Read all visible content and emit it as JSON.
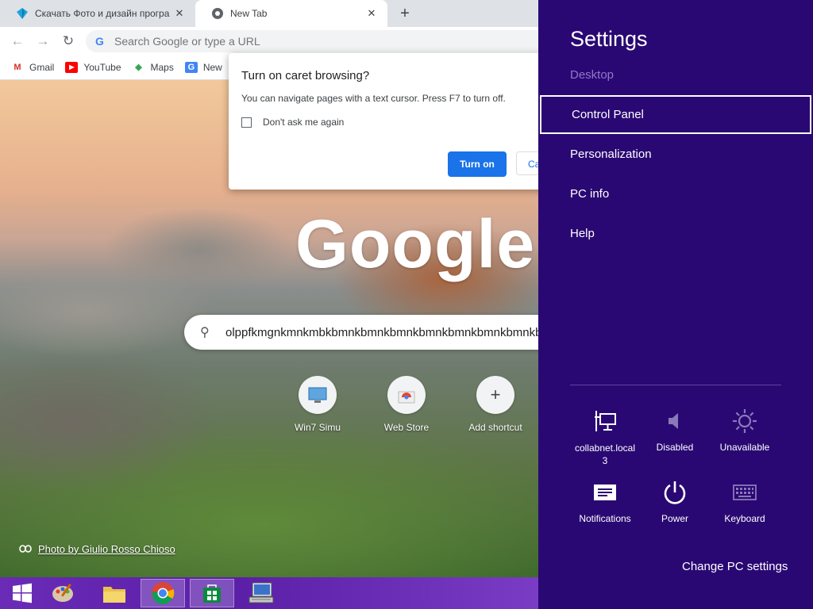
{
  "browser": {
    "tabs": [
      {
        "label": "Скачать Фото и дизайн програм",
        "close": "✕"
      },
      {
        "label": "New Tab",
        "close": "✕"
      }
    ],
    "new_tab_symbol": "+",
    "nav": {
      "back": "←",
      "forward": "→",
      "reload": "↻"
    },
    "omnibox": {
      "placeholder": "Search Google or type a URL",
      "g_glyph": "G"
    },
    "bookmarks": [
      {
        "label": "Gmail",
        "icon": "gmail-icon",
        "glyph": "M",
        "color": "#d93025"
      },
      {
        "label": "YouTube",
        "icon": "youtube-icon",
        "glyph": "▶",
        "color": "#ff0000"
      },
      {
        "label": "Maps",
        "icon": "maps-icon",
        "glyph": "◆",
        "color": "#34a853"
      },
      {
        "label": "New",
        "icon": "news-icon",
        "glyph": "G",
        "color": "#4285f4"
      }
    ]
  },
  "ntp": {
    "logo": "Google",
    "search_icon": "⚲",
    "search_text": "olppfkmgnkmnkmbkbmnkbmnkbmnkbmnkbmnkbmnkbmnkbmnkb",
    "shortcuts": [
      {
        "label": "Win7 Simu",
        "icon": "win7-simu-icon"
      },
      {
        "label": "Web Store",
        "icon": "web-store-icon"
      },
      {
        "label": "Add shortcut",
        "icon": "plus-icon",
        "glyph": "+"
      }
    ],
    "photo_credit": "Photo by Giulio Rosso Chioso"
  },
  "dialog": {
    "title": "Turn on caret browsing?",
    "body": "You can navigate pages with a text cursor. Press F7 to turn off.",
    "checkbox_label": "Don't ask me again",
    "primary_button": "Turn on",
    "secondary_button": "Ca"
  },
  "settings_charm": {
    "title": "Settings",
    "items": [
      "Desktop",
      "Control Panel",
      "Personalization",
      "PC info",
      "Help"
    ],
    "tiles": [
      {
        "label": "collabnet.local\n3",
        "icon": "network-icon"
      },
      {
        "label": "Disabled",
        "icon": "volume-icon"
      },
      {
        "label": "Unavailable",
        "icon": "brightness-icon"
      },
      {
        "label": "Notifications",
        "icon": "notifications-icon"
      },
      {
        "label": "Power",
        "icon": "power-icon"
      },
      {
        "label": "Keyboard",
        "icon": "keyboard-icon"
      }
    ],
    "change_pc_settings": "Change PC settings"
  },
  "colors": {
    "charm_bg": "#2a0873",
    "taskbar": "#6a2bb7",
    "primary_blue": "#1a73e8"
  }
}
